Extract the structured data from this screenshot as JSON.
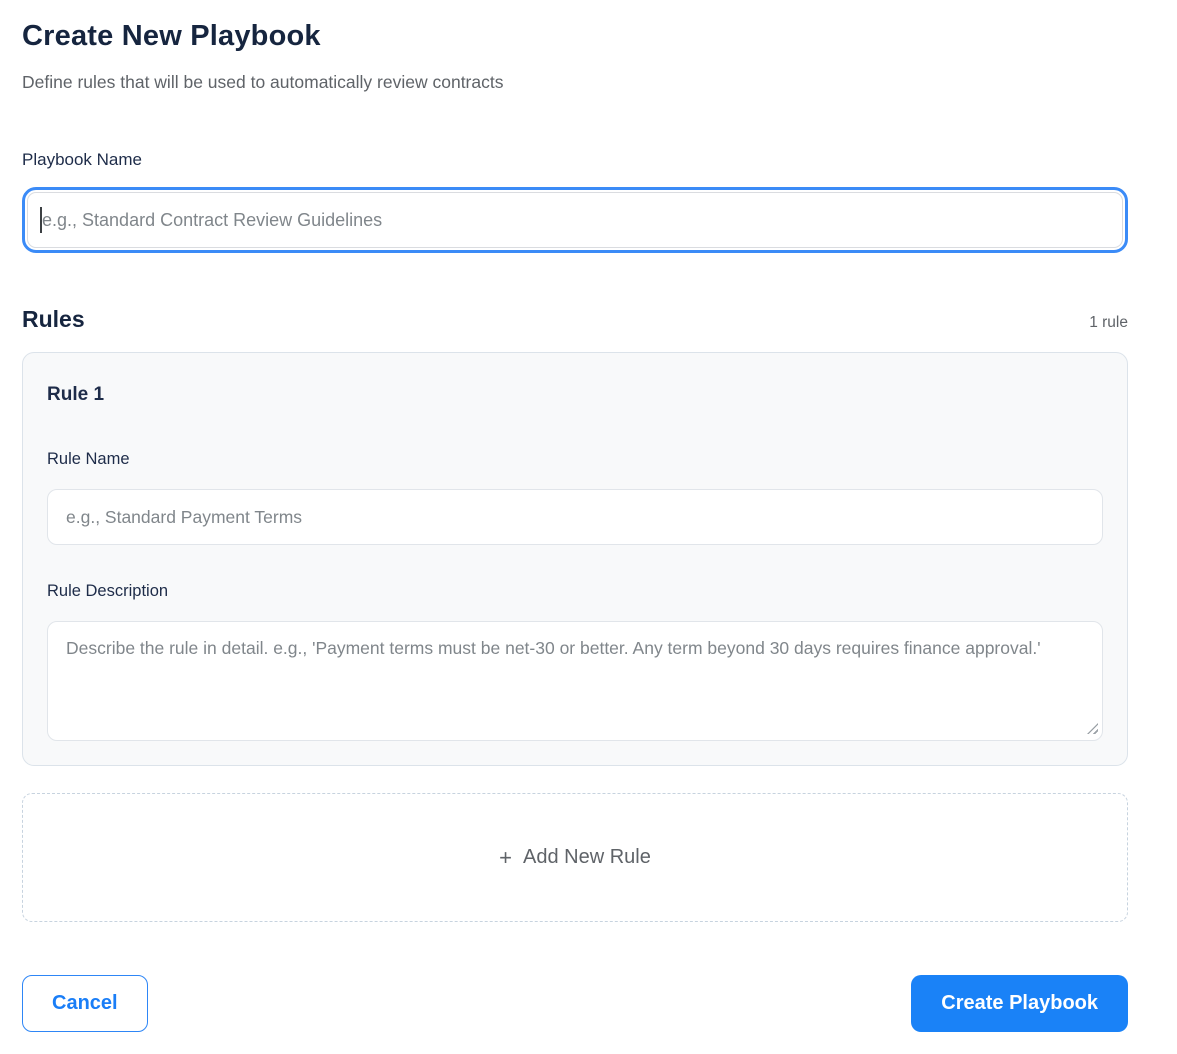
{
  "page": {
    "title": "Create New Playbook",
    "subtitle": "Define rules that will be used to automatically review contracts"
  },
  "playbook_name": {
    "label": "Playbook Name",
    "placeholder": "e.g., Standard Contract Review Guidelines",
    "value": ""
  },
  "rules_section": {
    "heading": "Rules",
    "count_label": "1 rule",
    "rules": [
      {
        "title": "Rule 1",
        "name_label": "Rule Name",
        "name_placeholder": "e.g., Standard Payment Terms",
        "name_value": "",
        "description_label": "Rule Description",
        "description_placeholder": "Describe the rule in detail. e.g., 'Payment terms must be net-30 or better. Any term beyond 30 days requires finance approval.'",
        "description_value": ""
      }
    ],
    "add_rule": {
      "icon": "+",
      "label": "Add New Rule"
    }
  },
  "footer": {
    "cancel_label": "Cancel",
    "submit_label": "Create Playbook"
  },
  "colors": {
    "accent_blue": "#1a82f7",
    "focus_ring_blue": "#3b8bf7",
    "heading_navy": "#16253f",
    "muted_gray": "#5f6368",
    "placeholder_gray": "#80868b",
    "card_background": "#f8f9fa",
    "card_border": "#dce3ea",
    "dashed_border": "#c7d3df"
  }
}
